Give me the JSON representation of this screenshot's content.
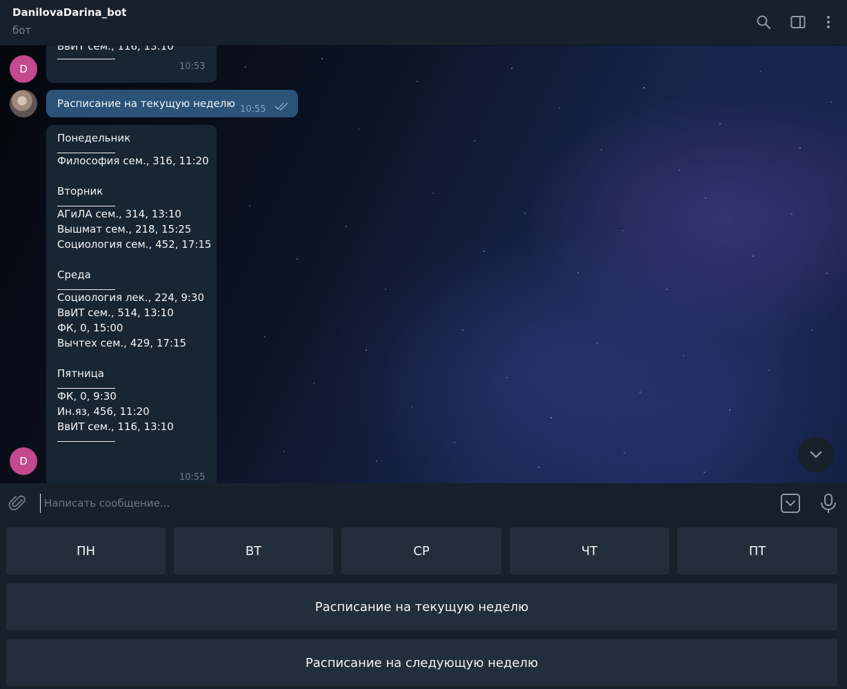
{
  "header": {
    "title": "DanilovaDarina_bot",
    "subtitle": "бот",
    "icons": [
      "search-icon",
      "sidebar-toggle-icon",
      "more-vertical-icon"
    ]
  },
  "messages": {
    "m1": {
      "lines": [
        "ВвИТ сем., 116, 13:10"
      ],
      "time": "10:53",
      "avatar": "D"
    },
    "m2": {
      "text": "Расписание на текущую неделю",
      "time": "10:55",
      "status": "read"
    },
    "m3": {
      "monday": "Понедельник",
      "monday_items": [
        "Философия сем., 316, 11:20"
      ],
      "tuesday": "Вторник",
      "tuesday_items": [
        "АГиЛА сем., 314, 13:10",
        "Вышмат сем., 218, 15:25",
        "Социология сем., 452, 17:15"
      ],
      "wednesday": "Среда",
      "wednesday_items": [
        "Социология лек., 224, 9:30",
        "ВвИТ сем., 514, 13:10",
        "ФК, 0, 15:00",
        "Вычтех сем., 429, 17:15"
      ],
      "friday": "Пятница",
      "friday_items": [
        "ФК, 0, 9:30",
        "Ин.яз, 456, 11:20",
        "ВвИТ сем., 116, 13:10"
      ],
      "time": "10:55",
      "avatar": "D"
    }
  },
  "composer": {
    "placeholder": "Написать сообщение..."
  },
  "keyboard": {
    "row1": [
      "ПН",
      "ВТ",
      "СР",
      "ЧТ",
      "ПТ"
    ],
    "current_week": "Расписание на текущую неделю",
    "next_week": "Расписание на следующую неделю"
  },
  "colors": {
    "bg": "#17212b",
    "bubble_in": "#182533",
    "bubble_out": "#2b5278",
    "avatar": "#c4498f",
    "button": "#232e3c"
  }
}
